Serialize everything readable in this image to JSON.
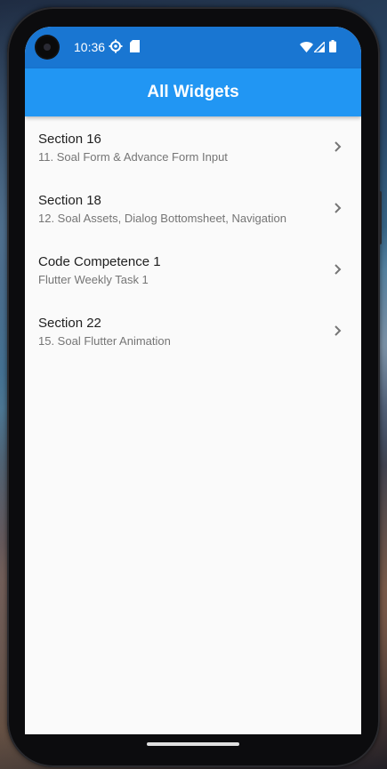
{
  "status_bar": {
    "time": "10:36",
    "icons": [
      "settings-gear-icon",
      "sim-card-icon",
      "wifi-icon",
      "cellular-signal-icon",
      "battery-icon"
    ]
  },
  "app_bar": {
    "title": "All Widgets",
    "color": "#2196f3"
  },
  "items": [
    {
      "title": "Section 16",
      "subtitle": "11. Soal Form & Advance Form Input",
      "icon": "chevron-right-icon"
    },
    {
      "title": "Section 18",
      "subtitle": "12. Soal Assets, Dialog Bottomsheet, Navigation",
      "icon": "chevron-right-icon"
    },
    {
      "title": "Code Competence 1",
      "subtitle": "Flutter Weekly Task 1",
      "icon": "chevron-right-icon"
    },
    {
      "title": "Section 22",
      "subtitle": "15. Soal Flutter Animation",
      "icon": "chevron-right-icon"
    }
  ]
}
